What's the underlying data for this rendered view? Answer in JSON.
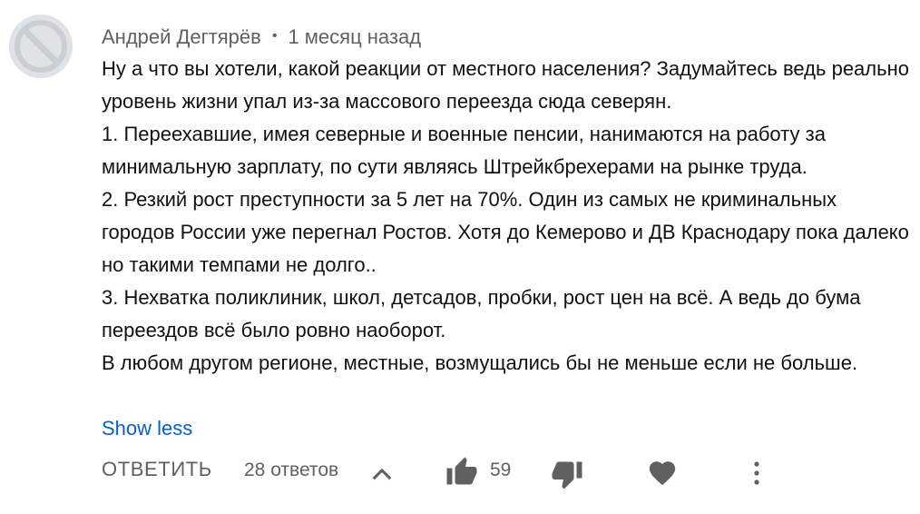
{
  "comment": {
    "author": "Андрей Дегтярёв",
    "separator": "•",
    "timestamp": "1 месяц назад",
    "paragraphs": [
      "Ну а что вы хотели, какой реакции от местного населения? Задумайтесь ведь реально уровень жизни упал из-за массового переезда сюда северян.",
      "1. Переехавшие, имея северные и военные пенсии, нанимаются на работу за минимальную зарплату, по сути являясь Штрейкбрехерами на рынке труда.",
      "2. Резкий рост преступности за 5 лет на 70%. Один из самых не криминальных городов России уже перегнал Ростов. Хотя до Кемерово и ДВ Краснодару пока далеко но такими темпами не долго..",
      "3. Нехватка поликлиник, школ, детсадов, пробки, рост цен на всё. А ведь до бума переездов всё было ровно наоборот.",
      "В любом другом регионе, местные, возмущались бы не меньше если не больше."
    ],
    "show_less_label": "Show less"
  },
  "actions": {
    "reply_label": "ОТВЕТИТЬ",
    "replies_count": "28 ответов",
    "like_count": "59"
  },
  "icons": {
    "avatar": "default-avatar-icon",
    "expand": "chevron-up-icon",
    "like": "thumb-up-icon",
    "dislike": "thumb-down-icon",
    "heart": "heart-icon",
    "more": "more-vert-icon"
  },
  "colors": {
    "text": "#111111",
    "secondary": "#606060",
    "link": "#065fd4",
    "icon": "#606060"
  }
}
